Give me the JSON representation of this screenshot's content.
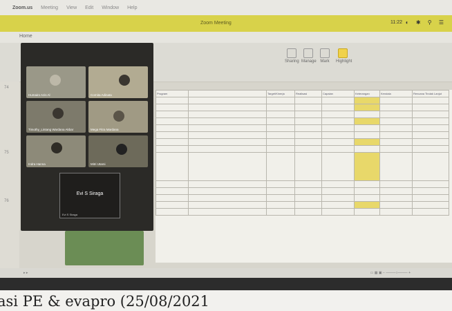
{
  "menubar": {
    "app": "Zoom.us",
    "items": [
      "Meeting",
      "View",
      "Edit",
      "Window",
      "Help"
    ]
  },
  "window": {
    "title": "Zoom Meeting",
    "clock": "11:22"
  },
  "tabbar": {
    "tab": "Home"
  },
  "ribbon": {
    "buttons": [
      "Sharing",
      "Manage",
      "Mark",
      "Highlight"
    ]
  },
  "participants": [
    {
      "name": "Humairo Azis Al"
    },
    {
      "name": "Cornita Adinata"
    },
    {
      "name": "Timothy_Lintang Wardana Akbar"
    },
    {
      "name": "Mega Fitra Mardana"
    },
    {
      "name": "Indra Hanna"
    },
    {
      "name": "Mitri Utami"
    }
  ],
  "active_speaker": {
    "name": "Evi S Siraga",
    "label": "Evi S Siraga"
  },
  "sheet": {
    "header": [
      "Program",
      "Target/Kinerja",
      "Realisasi",
      "Capaian",
      "Keterangan",
      "Kendala",
      "Rencana Tindak Lanjut"
    ]
  },
  "caption": {
    "text": "asi PE & evapro (25/08/2021"
  },
  "colors": {
    "accent": "#d8d24a",
    "highlight": "#e8d86a"
  }
}
